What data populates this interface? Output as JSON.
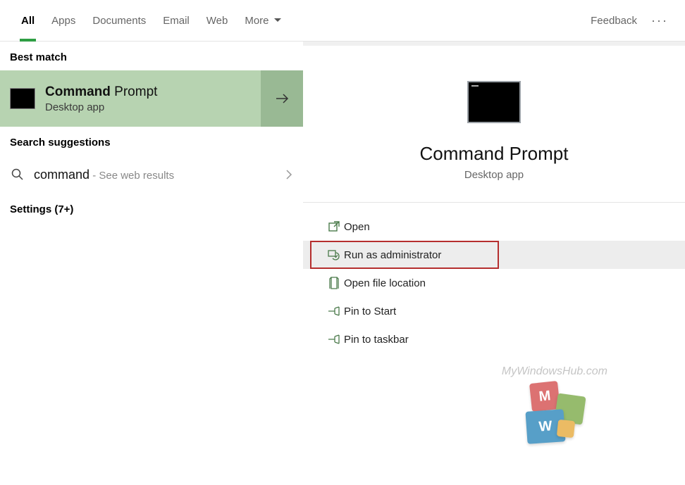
{
  "tabs": {
    "items": [
      {
        "label": "All",
        "active": true
      },
      {
        "label": "Apps",
        "active": false
      },
      {
        "label": "Documents",
        "active": false
      },
      {
        "label": "Email",
        "active": false
      },
      {
        "label": "Web",
        "active": false
      },
      {
        "label": "More",
        "active": false,
        "dropdown": true
      }
    ],
    "feedback": "Feedback"
  },
  "left": {
    "best_match_heading": "Best match",
    "best_match": {
      "title_bold": "Command",
      "title_rest": " Prompt",
      "subtitle": "Desktop app"
    },
    "suggestions_heading": "Search suggestions",
    "suggestion": {
      "query": "command",
      "hint": " - See web results"
    },
    "settings_heading": "Settings (7+)"
  },
  "right": {
    "title": "Command Prompt",
    "subtitle": "Desktop app",
    "actions": {
      "open": "Open",
      "run_admin": "Run as administrator",
      "open_loc": "Open file location",
      "pin_start": "Pin to Start",
      "pin_taskbar": "Pin to taskbar"
    }
  },
  "watermark": "MyWindowsHub.com"
}
